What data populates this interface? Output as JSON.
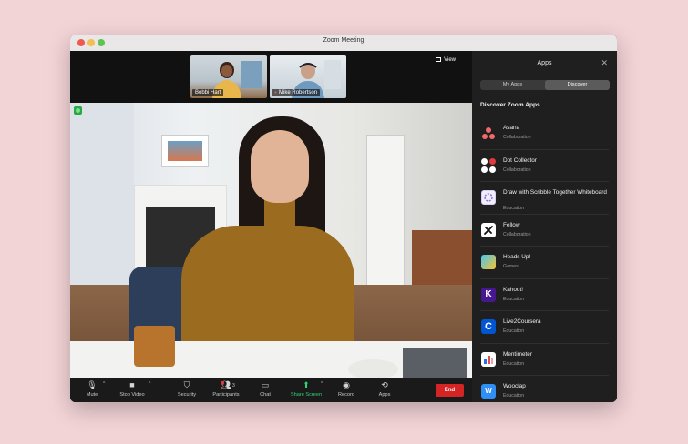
{
  "window": {
    "title": "Zoom Meeting"
  },
  "thumbnails": [
    {
      "name": "Bobbi Hart",
      "muted": false
    },
    {
      "name": "Mike Robertson",
      "muted": true
    }
  ],
  "view_label": "View",
  "toolbar": {
    "mute": "Mute",
    "stop_video": "Stop Video",
    "security": "Security",
    "participants": "Participants",
    "participants_count": "3",
    "chat": "Chat",
    "share_screen": "Share Screen",
    "record": "Record",
    "apps": "Apps",
    "end": "End"
  },
  "sidebar": {
    "title": "Apps",
    "tabs": [
      {
        "label": "My Apps",
        "active": false
      },
      {
        "label": "Discover",
        "active": true
      }
    ],
    "section_title": "Discover Zoom Apps",
    "apps": [
      {
        "name": "Asana",
        "category": "Collaboration",
        "icon": "asana-icon"
      },
      {
        "name": "Dot Collector",
        "category": "Collaboration",
        "icon": "dot-collector-icon"
      },
      {
        "name": "Draw with Scribble Together Whiteboard",
        "category": "Education",
        "icon": "scribble-icon"
      },
      {
        "name": "Fellow",
        "category": "Collaboration",
        "icon": "fellow-icon"
      },
      {
        "name": "Heads Up!",
        "category": "Games",
        "icon": "heads-up-icon"
      },
      {
        "name": "Kahoot!",
        "category": "Education",
        "icon": "kahoot-icon"
      },
      {
        "name": "Live2Coursera",
        "category": "Education",
        "icon": "coursera-icon"
      },
      {
        "name": "Mentimeter",
        "category": "Education",
        "icon": "mentimeter-icon"
      },
      {
        "name": "Wooclap",
        "category": "Education",
        "icon": "wooclap-icon"
      }
    ]
  },
  "colors": {
    "share_green": "#2ed573",
    "end_red": "#d42424",
    "background": "#f2d3d6"
  }
}
